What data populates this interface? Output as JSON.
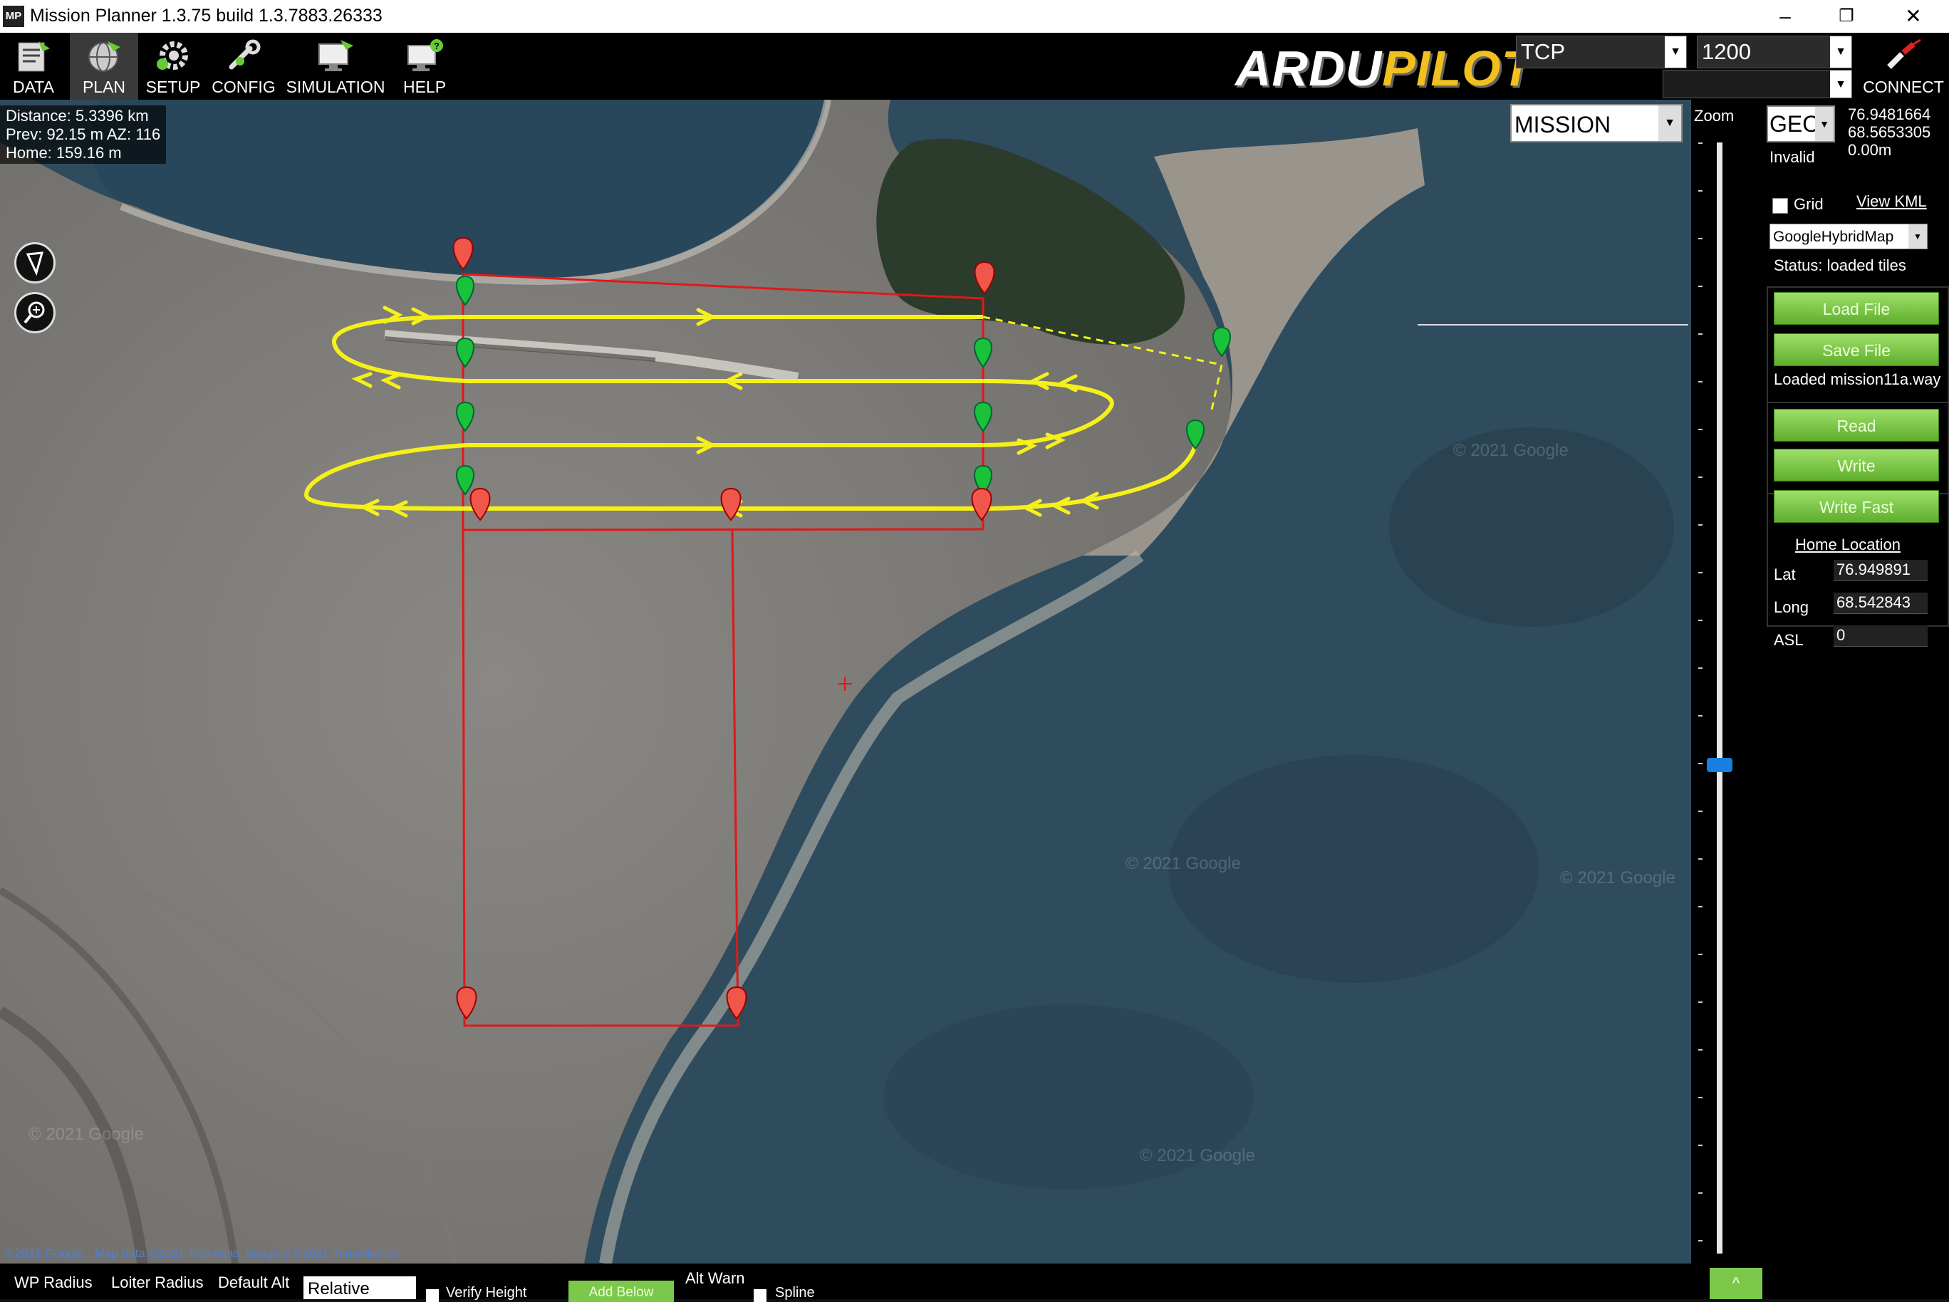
{
  "window": {
    "title": "Mission Planner 1.3.75 build 1.3.7883.26333",
    "app_icon_label": "MP",
    "minimize": "–",
    "maximize": "❐",
    "close": "✕"
  },
  "menu": {
    "items": [
      {
        "label": "DATA",
        "icon": "data-icon"
      },
      {
        "label": "PLAN",
        "icon": "plan-globe-icon"
      },
      {
        "label": "SETUP",
        "icon": "setup-gear-icon"
      },
      {
        "label": "CONFIG",
        "icon": "config-wrench-icon"
      },
      {
        "label": "SIMULATION",
        "icon": "simulation-monitor-icon"
      },
      {
        "label": "HELP",
        "icon": "help-monitor-icon"
      }
    ],
    "active": "PLAN"
  },
  "brand": {
    "part1": "ARDU",
    "part2": "PILOT"
  },
  "connection": {
    "type": "TCP",
    "baud": "1200",
    "secondary": "",
    "connect_label": "CONNECT"
  },
  "map_info": {
    "distance": "Distance: 5.3396 km",
    "prev": "Prev: 92.15 m AZ: 116",
    "home": "Home: 159.16 m"
  },
  "map": {
    "mode_select": "MISSION",
    "attribution": "©2021 Google - Map data ©2021 Tele Atlas, Imagery ©2021 TerraMetrics",
    "watermarks": [
      "© 2021 Google"
    ]
  },
  "zoom": {
    "label": "Zoom",
    "level_fraction": 0.56
  },
  "right_panel": {
    "coord_system": "GEO",
    "lat": "76.9481664",
    "lng": "68.5653305",
    "alt": "0.00m",
    "validity": "Invalid",
    "grid_label": "Grid",
    "grid_checked": false,
    "view_kml": "View KML",
    "map_provider": "GoogleHybridMap",
    "status": "Status: loaded tiles",
    "load_file": "Load File",
    "save_file": "Save File",
    "loaded_msg": "Loaded mission11a.way",
    "read": "Read",
    "write": "Write",
    "write_fast": "Write Fast",
    "home_location": "Home Location",
    "lat_label": "Lat",
    "lat_value": "76.949891",
    "long_label": "Long",
    "long_value": "68.542843",
    "asl_label": "ASL",
    "asl_value": "0"
  },
  "bottom_bar": {
    "wp_radius": "WP Radius",
    "loiter_radius": "Loiter Radius",
    "default_alt": "Default Alt",
    "alt_mode": "Relative",
    "verify_height": "Verify Height",
    "add_below": "Add Below",
    "alt_warn": "Alt Warn",
    "spline": "Spline",
    "expand": "^"
  },
  "colors": {
    "menubar_bg": "#000000",
    "button_green": "#7cc84a",
    "route_yellow": "#f5f01a",
    "polygon_red": "#e01818",
    "marker_green": "#19c23a",
    "marker_red": "#f0564a"
  }
}
